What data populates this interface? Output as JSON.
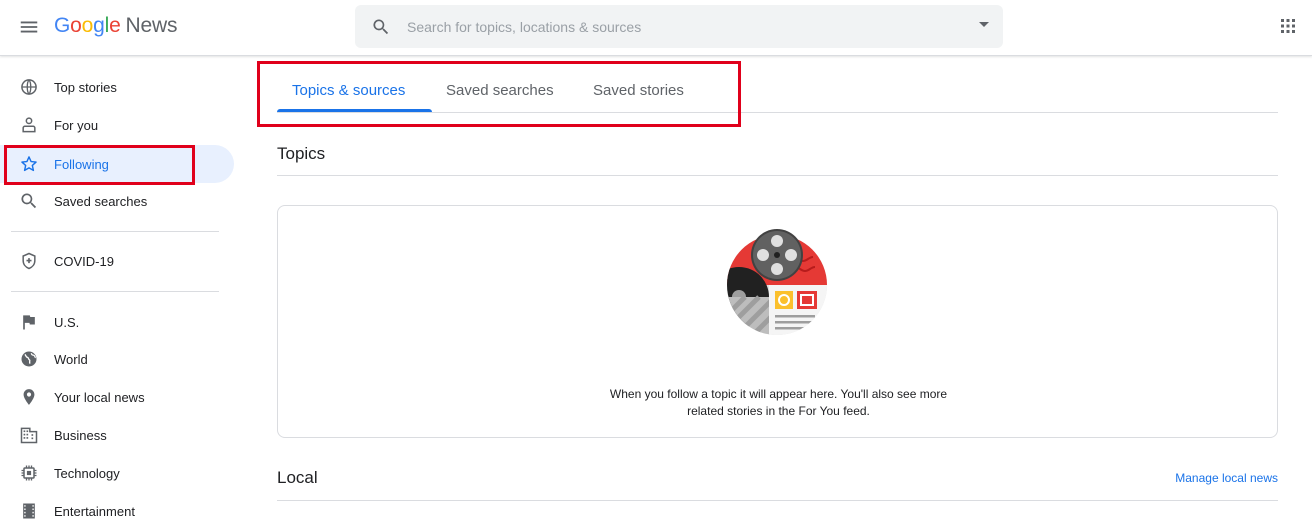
{
  "header": {
    "logo_google": [
      "G",
      "o",
      "o",
      "g",
      "l",
      "e"
    ],
    "logo_news": "News",
    "search_placeholder": "Search for topics, locations & sources"
  },
  "sidebar": {
    "items": [
      {
        "label": "Top stories",
        "icon": "globe-icon"
      },
      {
        "label": "For you",
        "icon": "person-icon"
      },
      {
        "label": "Following",
        "icon": "star-icon",
        "active": true
      },
      {
        "label": "Saved searches",
        "icon": "search-icon"
      },
      {
        "label": "COVID-19",
        "icon": "shield-plus-icon"
      },
      {
        "label": "U.S.",
        "icon": "flag-icon"
      },
      {
        "label": "World",
        "icon": "world-icon"
      },
      {
        "label": "Your local news",
        "icon": "location-pin-icon"
      },
      {
        "label": "Business",
        "icon": "building-icon"
      },
      {
        "label": "Technology",
        "icon": "chip-icon"
      },
      {
        "label": "Entertainment",
        "icon": "film-icon"
      }
    ]
  },
  "tabs": [
    {
      "label": "Topics & sources",
      "active": true
    },
    {
      "label": "Saved searches"
    },
    {
      "label": "Saved stories"
    }
  ],
  "topics": {
    "title": "Topics",
    "empty_line1": "When you follow a topic it will appear here. You'll also see more",
    "empty_line2": "related stories in the For You feed."
  },
  "local": {
    "title": "Local",
    "manage_link": "Manage local news"
  },
  "colors": {
    "accent": "#1a73e8",
    "active_bg": "#e8f0fe",
    "highlight": "#e0001b"
  }
}
